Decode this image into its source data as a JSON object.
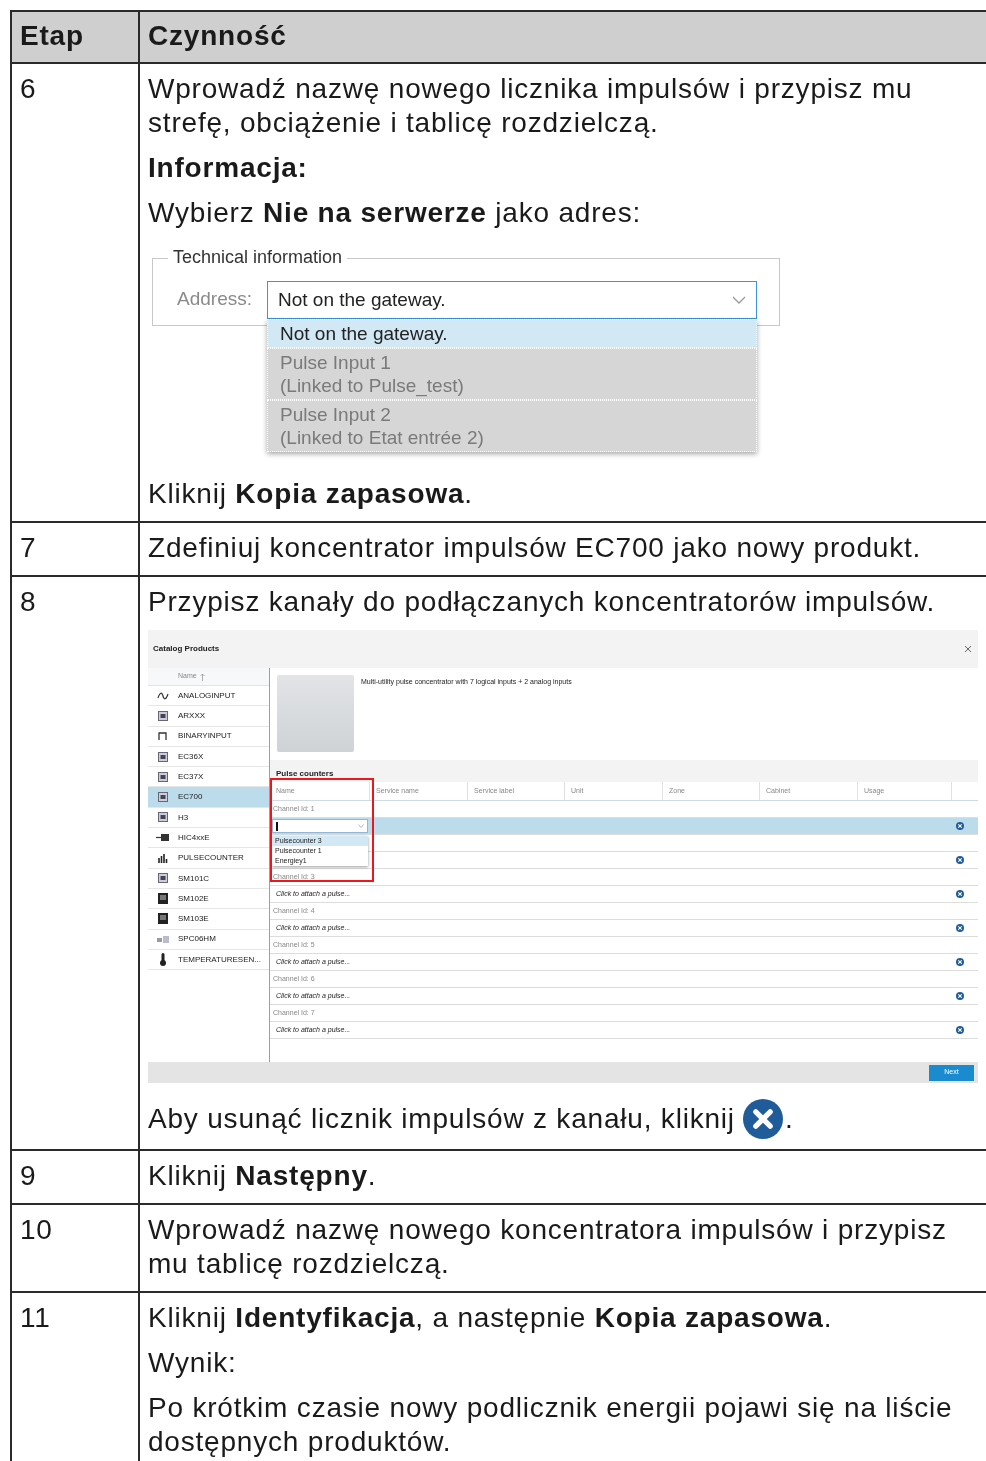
{
  "table": {
    "columns": [
      "Etap",
      "Czynność"
    ],
    "rows": [
      {
        "step": "6",
        "content": [
          {
            "kind": "text",
            "text": "Wprowadź nazwę nowego licznika impulsów i przypisz mu strefę, obciążenie i tablicę rozdzielczą."
          },
          {
            "kind": "heading",
            "text": "Informacja:"
          },
          {
            "kind": "text",
            "text": "Wybierz **Nie na serwerze** jako adres:"
          },
          {
            "kind": "address_figure",
            "legend": "Technical information",
            "label": "Address:",
            "value": "Not on the gateway.",
            "options": [
              {
                "label": "Not on the gateway.",
                "selected": true,
                "disabled": false
              },
              {
                "label": "Pulse Input 1",
                "detail": "(Linked to Pulse_test)",
                "selected": false,
                "disabled": true
              },
              {
                "label": "Pulse Input 2",
                "detail": "(Linked to Etat entrée 2)",
                "selected": false,
                "disabled": true
              }
            ]
          },
          {
            "kind": "text",
            "text": "Kliknij **Kopia zapasowa**."
          }
        ]
      },
      {
        "step": "7",
        "content": [
          {
            "kind": "text",
            "text": "Zdefiniuj koncentrator impulsów EC700 jako nowy produkt."
          }
        ]
      },
      {
        "step": "8",
        "content": [
          {
            "kind": "text",
            "text": "Przypisz kanały do podłączanych koncentratorów impulsów."
          },
          {
            "kind": "catalog_figure",
            "title": "Catalog Products",
            "list_header": "Name",
            "products": [
              {
                "name": "ANALOGINPUT",
                "selected": false
              },
              {
                "name": "ARXXX",
                "selected": false
              },
              {
                "name": "BINARYINPUT",
                "selected": false
              },
              {
                "name": "EC36X",
                "selected": false
              },
              {
                "name": "EC37X",
                "selected": false
              },
              {
                "name": "EC700",
                "selected": true
              },
              {
                "name": "H3",
                "selected": false
              },
              {
                "name": "HIC4xxE",
                "selected": false
              },
              {
                "name": "PULSECOUNTER",
                "selected": false
              },
              {
                "name": "SM101C",
                "selected": false
              },
              {
                "name": "SM102E",
                "selected": false
              },
              {
                "name": "SM103E",
                "selected": false
              },
              {
                "name": "SPC06HM",
                "selected": false
              },
              {
                "name": "TEMPERATURESEN...",
                "selected": false
              }
            ],
            "description": "Multi-utility pulse concentrator with 7 logical inputs + 2 analog inputs",
            "section": "Pulse counters",
            "columns": [
              "Name",
              "Service name",
              "Service label",
              "Unit",
              "Zone",
              "Cabinet",
              "Usage"
            ],
            "channels": [
              {
                "label": "Channel Id: 1",
                "selected": true,
                "editing": true
              },
              {
                "selected": false,
                "editing": false
              },
              {
                "label": "Channel Id: 3",
                "value": "Click to attach a pulse...",
                "selected": false,
                "editing": false
              },
              {
                "label": "Channel Id: 4",
                "value": "Click to attach a pulse...",
                "selected": false,
                "editing": false
              },
              {
                "label": "Channel Id: 5",
                "value": "Click to attach a pulse...",
                "selected": false,
                "editing": false
              },
              {
                "label": "Channel Id: 6",
                "value": "Click to attach a pulse...",
                "selected": false,
                "editing": false
              },
              {
                "label": "Channel Id: 7",
                "value": "Click to attach a pulse...",
                "selected": false,
                "editing": false
              }
            ],
            "dropdown": [
              {
                "label": "Pulsecounter 3",
                "selected": true
              },
              {
                "label": "Pulsecounter 1",
                "selected": false
              },
              {
                "label": "Energiey1",
                "selected": false
              }
            ],
            "next": "Next"
          },
          {
            "kind": "text_icon",
            "before": "Aby usunąć licznik impulsów z kanału, kliknij",
            "after": "."
          }
        ]
      },
      {
        "step": "9",
        "content": [
          {
            "kind": "text",
            "text": "Kliknij **Następny**."
          }
        ]
      },
      {
        "step": "10",
        "content": [
          {
            "kind": "text",
            "text": "Wprowadź nazwę nowego koncentratora impulsów i przypisz mu tablicę rozdzielczą."
          }
        ]
      },
      {
        "step": "11",
        "content": [
          {
            "kind": "text",
            "text": "Kliknij **Identyfikacja**, a następnie **Kopia zapasowa**."
          },
          {
            "kind": "text",
            "text": "Wynik:"
          },
          {
            "kind": "text",
            "text": "Po krótkim czasie nowy podlicznik energii pojawi się na liście dostępnych produktów."
          }
        ]
      }
    ]
  }
}
